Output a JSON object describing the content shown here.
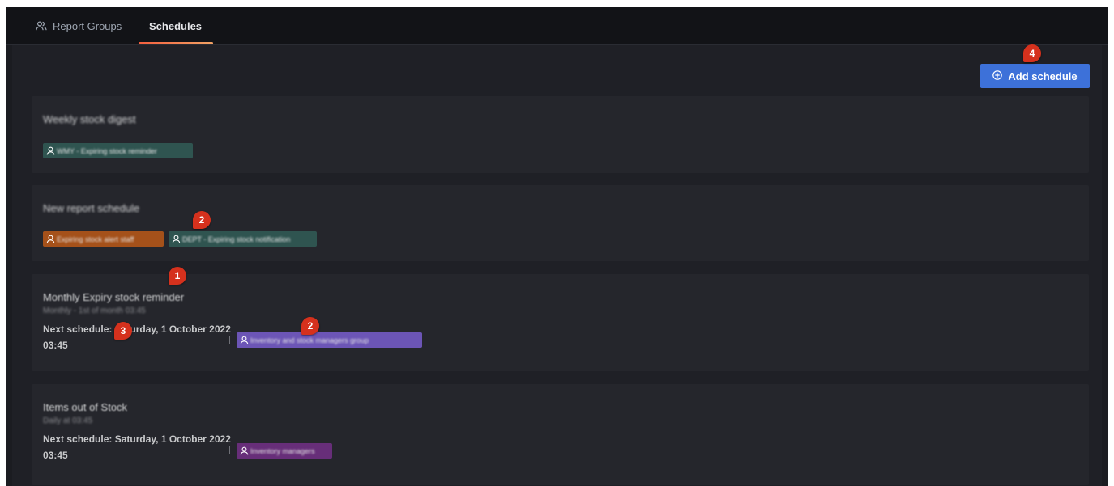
{
  "tabs": [
    {
      "label": "Report Groups",
      "icon": "users-icon"
    },
    {
      "label": "Schedules",
      "active": true
    }
  ],
  "actions": {
    "add_schedule_label": "Add schedule",
    "add_icon": "plus-circle-icon"
  },
  "schedules": [
    {
      "title": "Weekly stock digest",
      "chips": [
        {
          "label": "WMY - Expiring stock reminder",
          "color": "#2f5450"
        }
      ]
    },
    {
      "title": "New report schedule",
      "chips": [
        {
          "label": "Expiring stock alert staff",
          "color": "#a5511a"
        },
        {
          "label": "DEPT - Expiring stock notification",
          "color": "#2f5450"
        }
      ]
    },
    {
      "title": "Monthly Expiry stock reminder",
      "subtitle": "Monthly - 1st of month 03:45",
      "next_schedule": "Next schedule: Saturday, 1 October 2022 03:45",
      "chips": [
        {
          "label": "Inventory and stock managers group",
          "color": "#6c55b6"
        }
      ]
    },
    {
      "title": "Items out of Stock",
      "subtitle": "Daily at 03:45",
      "next_schedule": "Next schedule: Saturday, 1 October 2022 03:45",
      "chips": [
        {
          "label": "Inventory managers",
          "color": "#672e79"
        }
      ]
    }
  ],
  "annotations": [
    "1",
    "2",
    "2",
    "3",
    "4"
  ]
}
